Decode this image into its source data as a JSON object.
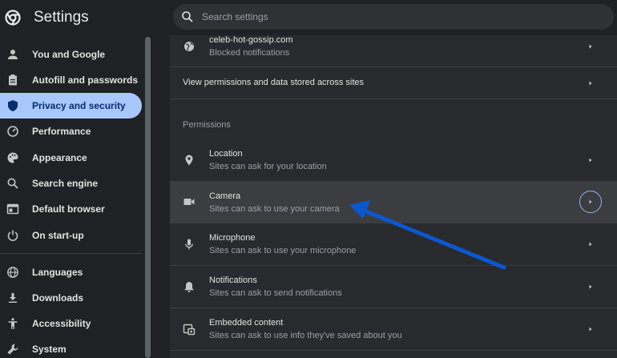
{
  "header": {
    "title": "Settings",
    "search_placeholder": "Search settings"
  },
  "sidebar": {
    "items": [
      {
        "label": "You and Google",
        "icon": "person-icon"
      },
      {
        "label": "Autofill and passwords",
        "icon": "clipboard-icon"
      },
      {
        "label": "Privacy and security",
        "icon": "shield-icon",
        "active": true
      },
      {
        "label": "Performance",
        "icon": "gauge-icon"
      },
      {
        "label": "Appearance",
        "icon": "palette-icon"
      },
      {
        "label": "Search engine",
        "icon": "search-icon"
      },
      {
        "label": "Default browser",
        "icon": "browser-icon"
      },
      {
        "label": "On start-up",
        "icon": "power-icon"
      },
      {
        "label": "Languages",
        "icon": "globe-icon"
      },
      {
        "label": "Downloads",
        "icon": "download-icon"
      },
      {
        "label": "Accessibility",
        "icon": "accessibility-icon"
      },
      {
        "label": "System",
        "icon": "wrench-icon"
      }
    ]
  },
  "main": {
    "site_row": {
      "title": "celeb-hot-gossip.com",
      "subtitle": "Blocked notifications",
      "icon": "globe-icon"
    },
    "view_permissions": "View permissions and data stored across sites",
    "permissions_header": "Permissions",
    "permissions": [
      {
        "title": "Location",
        "subtitle": "Sites can ask for your location",
        "icon": "location-icon"
      },
      {
        "title": "Camera",
        "subtitle": "Sites can ask to use your camera",
        "icon": "camera-icon"
      },
      {
        "title": "Microphone",
        "subtitle": "Sites can ask to use your microphone",
        "icon": "microphone-icon"
      },
      {
        "title": "Notifications",
        "subtitle": "Sites can ask to send notifications",
        "icon": "bell-icon"
      },
      {
        "title": "Embedded content",
        "subtitle": "Sites can ask to use info they've saved about you",
        "icon": "embedded-content-icon"
      }
    ]
  },
  "colors": {
    "background": "#202124",
    "panel": "#292a2d",
    "active_nav": "#a8c7fa",
    "annotation_arrow": "#0b57d0"
  }
}
